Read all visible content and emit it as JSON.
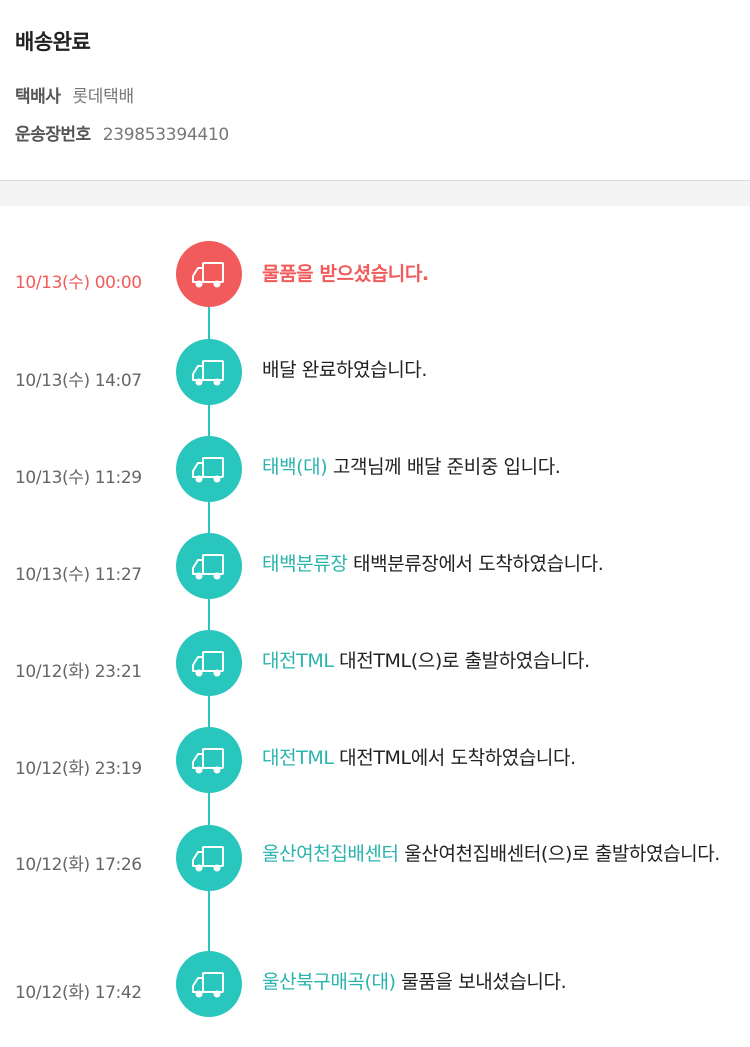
{
  "header": {
    "status_title": "배송완료",
    "carrier_label": "택배사",
    "carrier_value": "롯데택배",
    "tracking_label": "운송장번호",
    "tracking_value": "239853394410"
  },
  "colors": {
    "accent": "#29c6bd",
    "current": "#f15b5b",
    "location_text": "#29b4ad"
  },
  "events": [
    {
      "time": "10/13(수) 00:00",
      "location": "",
      "message": "물품을 받으셨습니다.",
      "icon": "truck-icon",
      "current": true
    },
    {
      "time": "10/13(수) 14:07",
      "location": "",
      "message": "배달 완료하였습니다.",
      "icon": "truck-icon",
      "current": false
    },
    {
      "time": "10/13(수) 11:29",
      "location": "태백(대)",
      "message": " 고객님께 배달 준비중 입니다.",
      "icon": "truck-icon",
      "current": false
    },
    {
      "time": "10/13(수) 11:27",
      "location": "태백분류장",
      "message": " 태백분류장에서 도착하였습니다.",
      "icon": "truck-icon",
      "current": false
    },
    {
      "time": "10/12(화) 23:21",
      "location": "대전TML",
      "message": " 대전TML(으)로 출발하였습니다.",
      "icon": "truck-icon",
      "current": false
    },
    {
      "time": "10/12(화) 23:19",
      "location": "대전TML",
      "message": " 대전TML에서 도착하였습니다.",
      "icon": "truck-icon",
      "current": false
    },
    {
      "time": "10/12(화) 17:26",
      "location": "울산여천집배센터",
      "message": " 울산여천집배센터(으)로 출발하였습니다.",
      "icon": "truck-icon",
      "current": false
    },
    {
      "time": "10/12(화) 17:42",
      "location": "울산북구매곡(대)",
      "message": " 물품을 보내셨습니다.",
      "icon": "truck-icon",
      "current": false
    }
  ]
}
